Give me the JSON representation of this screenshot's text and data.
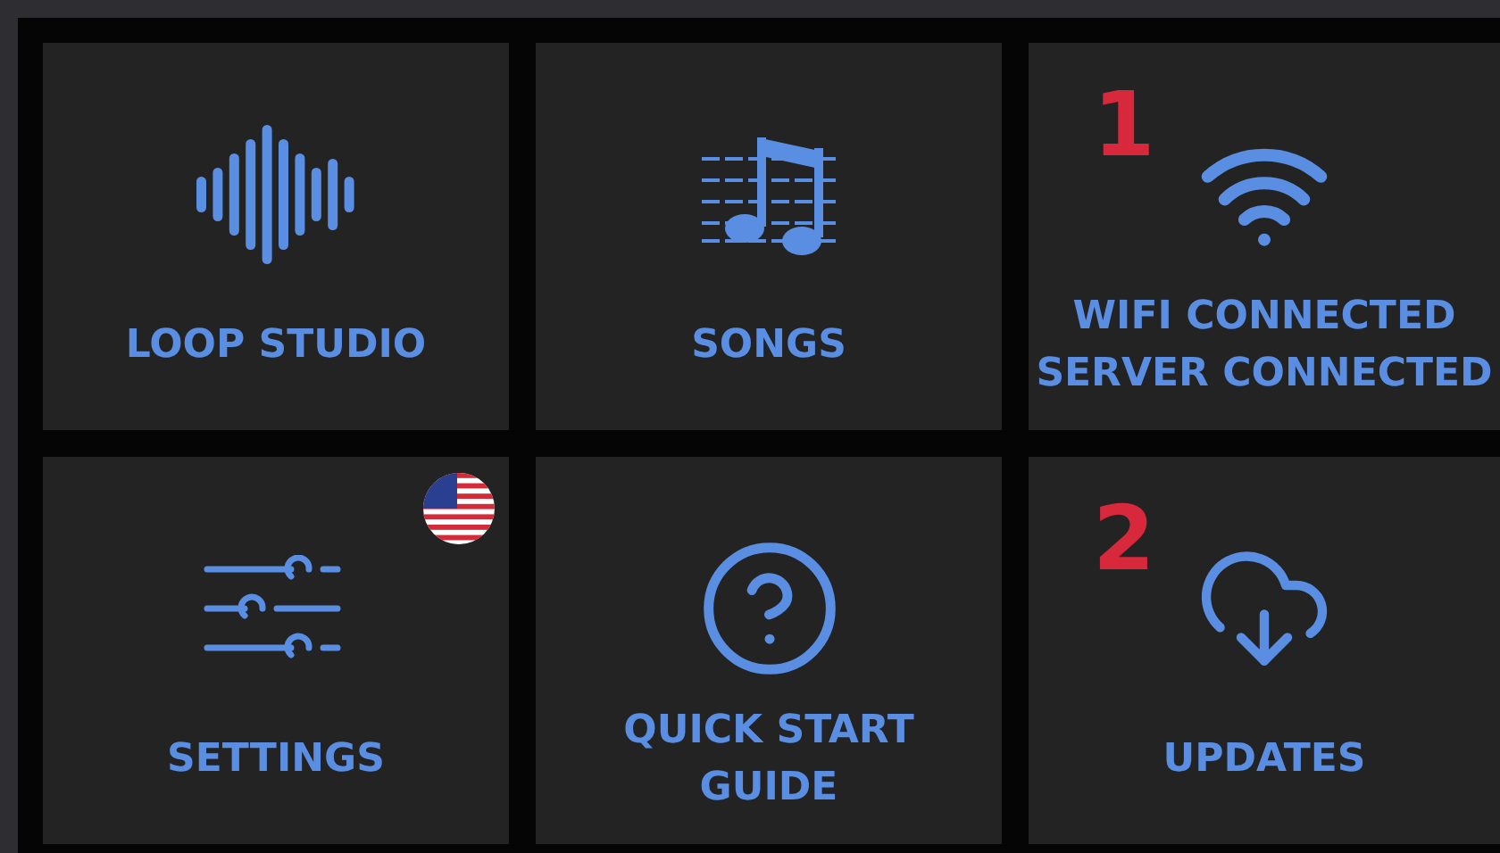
{
  "tiles": [
    {
      "label": [
        "LOOP STUDIO"
      ]
    },
    {
      "label": [
        "SONGS"
      ]
    },
    {
      "label": [
        "WIFI CONNECTED",
        "SERVER CONNECTED"
      ],
      "callout": "1"
    },
    {
      "label": [
        "SETTINGS"
      ]
    },
    {
      "label": [
        "QUICK START",
        "GUIDE"
      ]
    },
    {
      "label": [
        "UPDATES"
      ],
      "callout": "2"
    }
  ]
}
